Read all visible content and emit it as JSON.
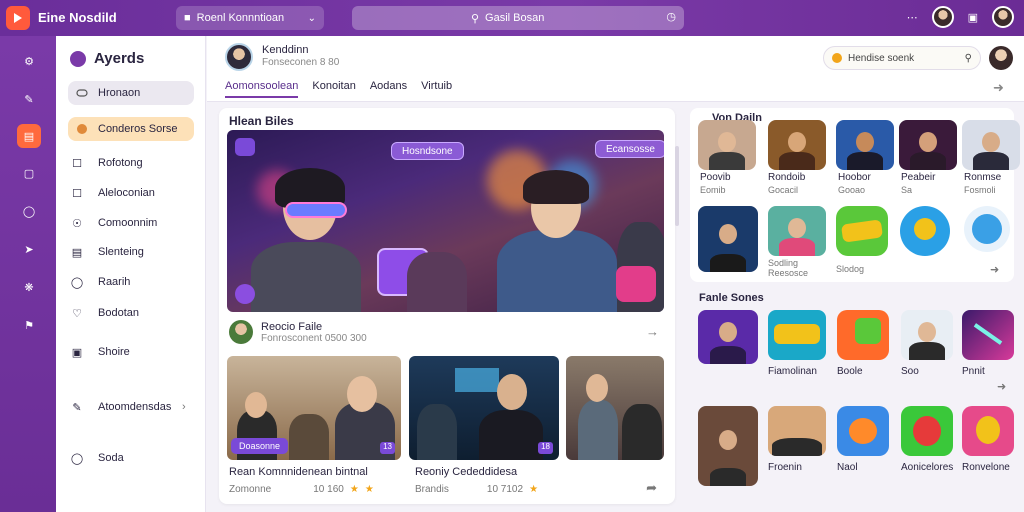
{
  "topbar": {
    "app_title": "Eine Nosdild",
    "workspace": "Roenl Konnntioan",
    "search_placeholder": "Gasil Bosan"
  },
  "nav": {
    "title": "Ayerds",
    "pill_grey": "Hronaon",
    "pill_orange": "Conderos Sorse",
    "items": [
      {
        "label": "Rofotong",
        "icon": "checkbox-icon"
      },
      {
        "label": "Aleloconian",
        "icon": "checkbox-icon"
      },
      {
        "label": "Comoonnim",
        "icon": "shield-icon"
      },
      {
        "label": "Slenteing",
        "icon": "list-icon"
      },
      {
        "label": "Raarih",
        "icon": "shield-icon"
      },
      {
        "label": "Bodotan",
        "icon": "heart-icon"
      },
      {
        "label": "Shoire",
        "icon": "comment-icon"
      },
      {
        "label": "Atoomdensdas",
        "icon": "pencil-icon"
      },
      {
        "label": "Soda",
        "icon": "comment-icon"
      }
    ]
  },
  "profile": {
    "name": "Kenddinn",
    "sub": "Fonseconen 8 80",
    "tabs": [
      "Aomonsoolean",
      "Konoitan",
      "Aodans",
      "Virtuib"
    ],
    "search_value": "Hendise soenk"
  },
  "feed": {
    "title": "Hlean Biles",
    "hero_chip_1": "Hosndsone",
    "hero_chip_2": "Ecansosse",
    "post_name": "Reocio Faile",
    "post_sub": "Fonrosconent 0500 300",
    "thumbs": [
      {
        "caption": "Rean Komnnidenean bintnal",
        "author": "Zomonne",
        "meta": "10 160",
        "tag": "Doasonne",
        "count": "13"
      },
      {
        "caption": "Reoniy Cededdidesa",
        "author": "Brandis",
        "meta": "10 7102",
        "tag": "",
        "count": "18"
      }
    ]
  },
  "right1": {
    "title": "Von Dailn",
    "apps": [
      {
        "label": "Poovib",
        "sub": "Eomib"
      },
      {
        "label": "Rondoib",
        "sub": "Gocacil"
      },
      {
        "label": "Hoobor",
        "sub": "Gooao"
      },
      {
        "label": "Peabeir",
        "sub": "Sa"
      },
      {
        "label": "Ronmse",
        "sub": "Fosmoli"
      }
    ],
    "row2_sub": "Sodling Reesosce",
    "row2_extra": "Slodog"
  },
  "right2": {
    "title": "Fanle Sones",
    "apps": [
      {
        "label": "Fiamolinan"
      },
      {
        "label": "Boole"
      },
      {
        "label": "Soo"
      },
      {
        "label": "Pnnit"
      }
    ],
    "apps2": [
      {
        "label": "Froenin"
      },
      {
        "label": "Naol"
      },
      {
        "label": "Aonicelores"
      },
      {
        "label": "Ronvelone"
      }
    ]
  },
  "colors": {
    "brand_purple": "#7a3aa8",
    "accent_orange": "#ff6a3d",
    "star": "#f2a51a"
  }
}
